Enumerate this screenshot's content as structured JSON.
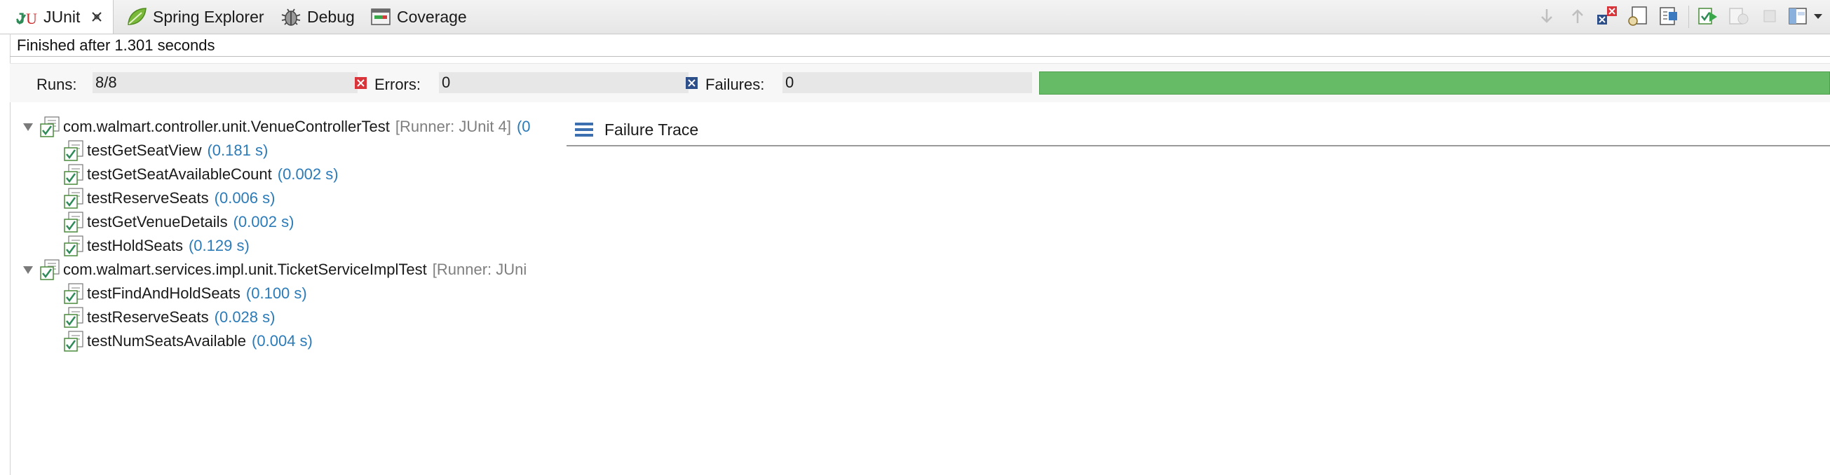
{
  "tabs": [
    {
      "label": "JUnit",
      "icon": "junit-icon",
      "active": true
    },
    {
      "label": "Spring Explorer",
      "icon": "spring-leaf-icon"
    },
    {
      "label": "Debug",
      "icon": "bug-icon"
    },
    {
      "label": "Coverage",
      "icon": "coverage-icon"
    }
  ],
  "status": "Finished after 1.301 seconds",
  "counters": {
    "runs_label": "Runs:",
    "runs_value": "8/8",
    "errors_label": "Errors:",
    "errors_value": "0",
    "failures_label": "Failures:",
    "failures_value": "0"
  },
  "progress": {
    "fraction": 1.0,
    "color": "#66bb66"
  },
  "tree": [
    {
      "name": "com.walmart.controller.unit.VenueControllerTest",
      "runner": "[Runner: JUnit 4]",
      "time_fragment": "(0",
      "tests": [
        {
          "name": "testGetSeatView",
          "time": "(0.181 s)"
        },
        {
          "name": "testGetSeatAvailableCount",
          "time": "(0.002 s)"
        },
        {
          "name": "testReserveSeats",
          "time": "(0.006 s)"
        },
        {
          "name": "testGetVenueDetails",
          "time": "(0.002 s)"
        },
        {
          "name": "testHoldSeats",
          "time": "(0.129 s)"
        }
      ]
    },
    {
      "name": "com.walmart.services.impl.unit.TicketServiceImplTest",
      "runner": "[Runner: JUni",
      "tests": [
        {
          "name": "testFindAndHoldSeats",
          "time": "(0.100 s)"
        },
        {
          "name": "testReserveSeats",
          "time": "(0.028 s)"
        },
        {
          "name": "testNumSeatsAvailable",
          "time": "(0.004 s)"
        }
      ]
    }
  ],
  "trace": {
    "title": "Failure Trace",
    "icon": "stack-trace-icon"
  },
  "toolbar": [
    "next-failure-icon",
    "previous-failure-icon",
    "show-failures-only-icon",
    "scroll-lock-icon",
    "history-icon",
    "rerun-icon",
    "rerun-failed-first-icon",
    "stop-icon",
    "layout-icon",
    "view-menu-icon"
  ],
  "colors": {
    "time": "#2b7bb9",
    "runner": "#7f7f7f",
    "success": "#66bb66",
    "error": "#d9343a"
  }
}
